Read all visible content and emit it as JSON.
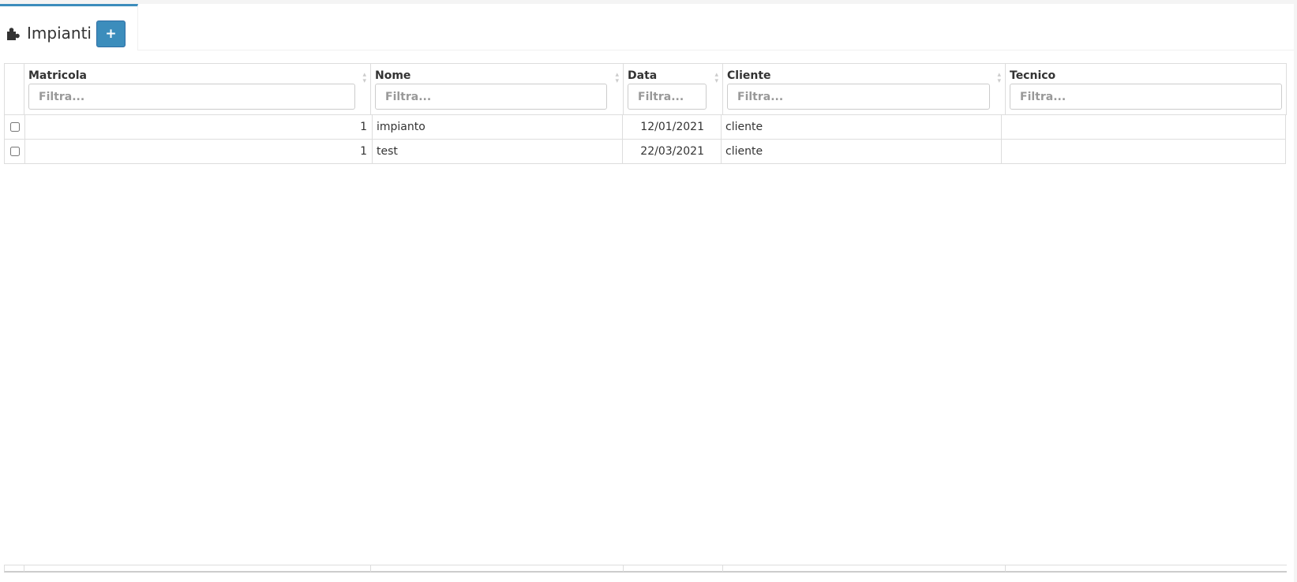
{
  "tab": {
    "title": "Impianti",
    "add_label": "+"
  },
  "table": {
    "columns": [
      {
        "label": "Matricola",
        "placeholder": "Filtra..."
      },
      {
        "label": "Nome",
        "placeholder": "Filtra..."
      },
      {
        "label": "Data",
        "placeholder": "Filtra..."
      },
      {
        "label": "Cliente",
        "placeholder": "Filtra..."
      },
      {
        "label": "Tecnico",
        "placeholder": "Filtra..."
      }
    ],
    "rows": [
      {
        "matricola": "1",
        "nome": "impianto",
        "data": "12/01/2021",
        "cliente": "cliente",
        "tecnico": ""
      },
      {
        "matricola": "1",
        "nome": "test",
        "data": "22/03/2021",
        "cliente": "cliente",
        "tecnico": ""
      }
    ]
  },
  "colors": {
    "accent": "#3c8dbc",
    "border": "#dddddd"
  },
  "icons": {
    "tab_icon": "puzzle-piece-icon",
    "add_icon": "plus-icon",
    "sort_icon": "sort-icon"
  }
}
